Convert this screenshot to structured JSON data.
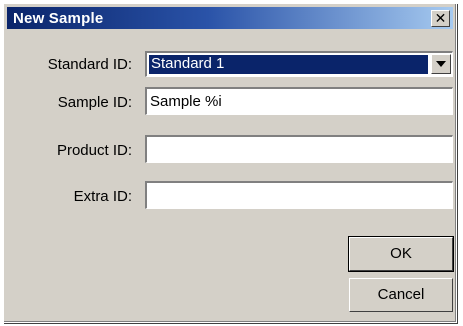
{
  "window": {
    "title": "New Sample",
    "close_symbol": "✕"
  },
  "fields": {
    "standard_id": {
      "label": "Standard ID:",
      "value": "Standard 1"
    },
    "sample_id": {
      "label": "Sample ID:",
      "value": "Sample %i"
    },
    "product_id": {
      "label": "Product ID:",
      "value": ""
    },
    "extra_id": {
      "label": "Extra ID:",
      "value": ""
    }
  },
  "buttons": {
    "ok": "OK",
    "cancel": "Cancel"
  },
  "icons": {
    "close": "close-icon",
    "dropdown": "chevron-down-icon"
  }
}
